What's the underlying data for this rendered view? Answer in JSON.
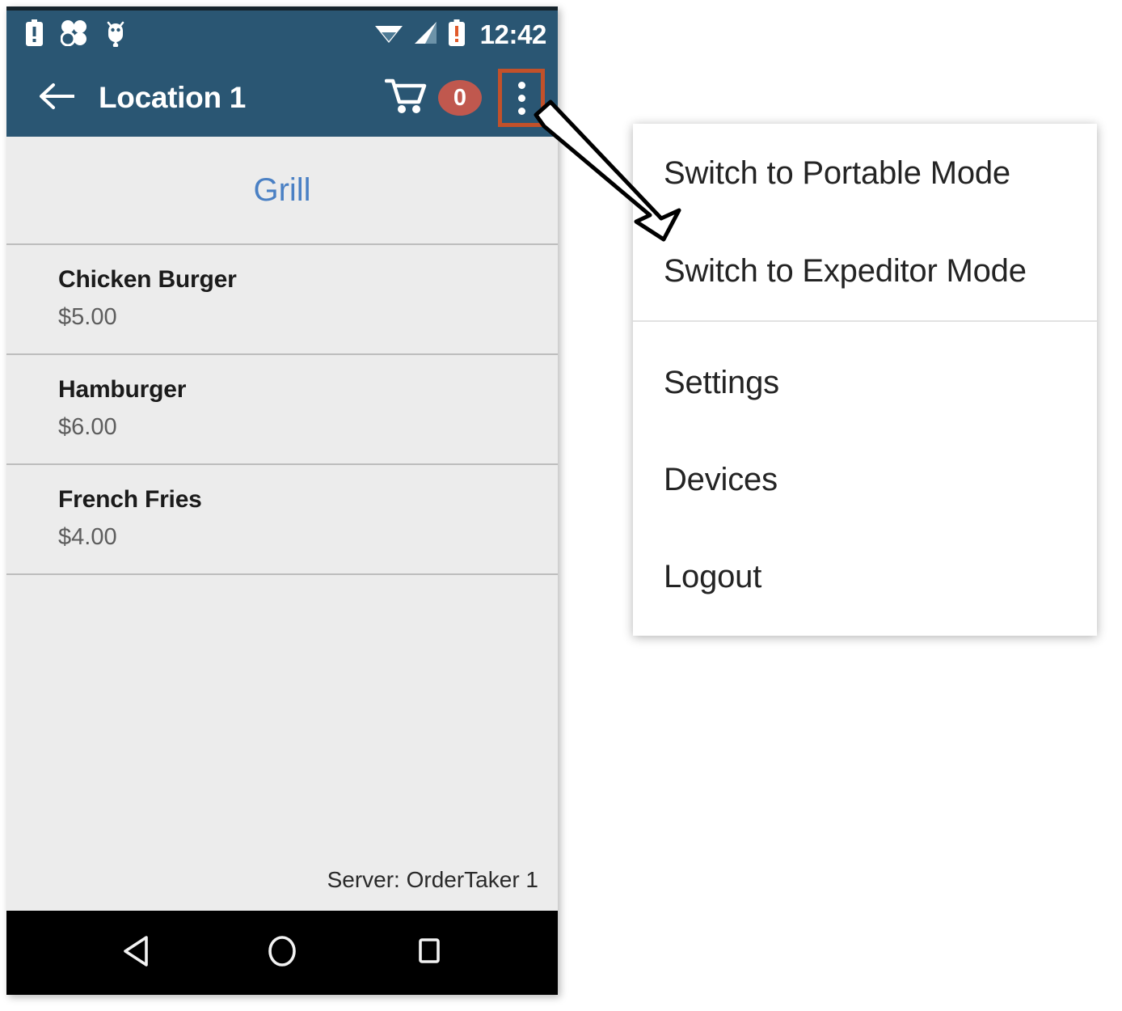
{
  "phone": {
    "status_bar": {
      "icons_left": [
        "battery-alert-icon",
        "clover-icon",
        "android-debug-icon"
      ],
      "icons_right": [
        "wifi-icon",
        "signal-icon",
        "battery-alert-icon"
      ],
      "clock": "12:42"
    },
    "app_bar": {
      "back_icon": "back-arrow-icon",
      "title": "Location 1",
      "cart_icon": "shopping-cart-icon",
      "cart_count": "0",
      "overflow_icon": "overflow-menu-icon",
      "bg_color": "#2a5673",
      "badge_color": "#c0584e",
      "highlight_color": "#c2512a"
    },
    "content": {
      "category": "Grill",
      "category_color": "#4a80c4",
      "items": [
        {
          "name": "Chicken Burger",
          "price": "$5.00"
        },
        {
          "name": "Hamburger",
          "price": "$6.00"
        },
        {
          "name": "French Fries",
          "price": "$4.00"
        }
      ],
      "server_label": "Server: OrderTaker 1"
    },
    "nav_bar": {
      "back_icon": "nav-back-triangle-icon",
      "home_icon": "nav-home-circle-icon",
      "recents_icon": "nav-recents-square-icon"
    }
  },
  "popup_menu": {
    "groups": [
      {
        "items": [
          {
            "label": "Switch to Portable Mode"
          },
          {
            "label": "Switch to Expeditor Mode"
          }
        ]
      },
      {
        "items": [
          {
            "label": "Settings"
          },
          {
            "label": "Devices"
          },
          {
            "label": "Logout"
          }
        ]
      }
    ]
  },
  "annotation": {
    "arrow": "callout-arrow",
    "arrow_fill": "#ffffff",
    "arrow_stroke": "#000000"
  }
}
